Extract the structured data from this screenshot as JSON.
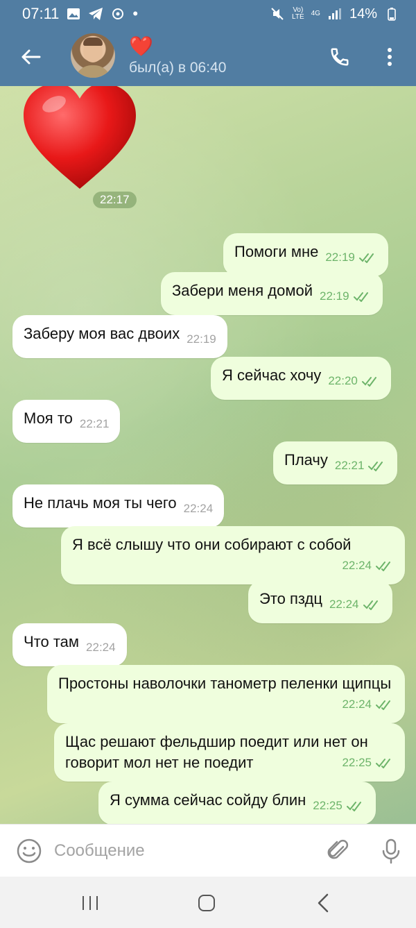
{
  "status_bar": {
    "time": "07:11",
    "network_lte": "LTE",
    "network_4g": "4G",
    "battery": "14%"
  },
  "header": {
    "name_emoji": "❤️",
    "last_seen": "был(а) в 06:40"
  },
  "chat": {
    "sticker_time": "22:17",
    "messages": [
      {
        "dir": "out",
        "text": "Помоги мне",
        "time": "22:19"
      },
      {
        "dir": "out",
        "text": "Забери меня домой",
        "time": "22:19"
      },
      {
        "dir": "in",
        "text": "Заберу моя вас двоих",
        "time": "22:19"
      },
      {
        "dir": "out",
        "text": "Я сейчас хочу",
        "time": "22:20"
      },
      {
        "dir": "in",
        "text": "Моя то",
        "time": "22:21"
      },
      {
        "dir": "out",
        "text": "Плачу",
        "time": "22:21"
      },
      {
        "dir": "in",
        "text": "Не плачь моя ты чего",
        "time": "22:24"
      },
      {
        "dir": "out",
        "text": "Я всё слышу что они собирают с собой",
        "time": "22:24"
      },
      {
        "dir": "out",
        "text": "Это пздц",
        "time": "22:24"
      },
      {
        "dir": "in",
        "text": "Что там",
        "time": "22:24"
      },
      {
        "dir": "out",
        "text": "Простоны наволочки танометр пеленки щипцы",
        "time": "22:24"
      },
      {
        "dir": "out",
        "text": "Щас решают фельдшир поедит или нет он говорит мол нет не поедит",
        "time": "22:25"
      },
      {
        "dir": "out",
        "text": "Я сумма сейчас сойду блин",
        "time": "22:25"
      }
    ]
  },
  "composer": {
    "placeholder": "Сообщение"
  },
  "colors": {
    "header": "#517da2",
    "outgoing_bubble": "#effedd",
    "incoming_bubble": "#ffffff",
    "read_check": "#6db46a"
  },
  "icons": [
    "back-arrow-icon",
    "phone-icon",
    "more-vert-icon",
    "emoji-icon",
    "attach-icon",
    "mic-icon",
    "recents-icon",
    "home-icon",
    "nav-back-icon"
  ]
}
